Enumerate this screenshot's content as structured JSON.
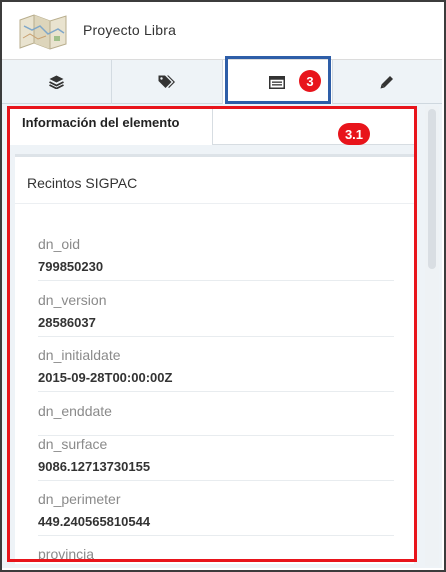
{
  "header": {
    "app_title": "Proyecto Libra",
    "map_icon": "folded-map-icon"
  },
  "toolbar": {
    "tabs": [
      {
        "icon": "layers-icon"
      },
      {
        "icon": "tags-icon"
      },
      {
        "icon": "table-list-icon",
        "active": true
      },
      {
        "icon": "pencil-icon"
      }
    ]
  },
  "annotations": {
    "badge_tabs": "3",
    "badge_panel": "3.1",
    "highlight_blue": "#2e5ea8",
    "highlight_red": "#e8141b"
  },
  "panel": {
    "subtab_label": "Información del elemento",
    "card_title": "Recintos SIGPAC",
    "attributes": [
      {
        "label": "dn_oid",
        "value": "799850230"
      },
      {
        "label": "dn_version",
        "value": "28586037"
      },
      {
        "label": "dn_initialdate",
        "value": "2015-09-28T00:00:00Z"
      },
      {
        "label": "dn_enddate",
        "value": ""
      },
      {
        "label": "dn_surface",
        "value": "9086.12713730155"
      },
      {
        "label": "dn_perimeter",
        "value": "449.240565810544"
      },
      {
        "label": "provincia",
        "value": ""
      }
    ]
  }
}
